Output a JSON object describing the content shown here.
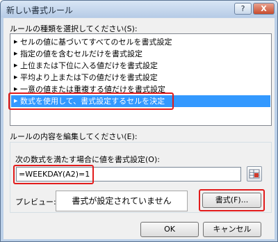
{
  "dialog": {
    "title": "新しい書式ルール",
    "help_label": "?",
    "close_label": "X"
  },
  "rule_type": {
    "label": "ルールの種類を選択してください(S):",
    "items": [
      "セルの値に基づいてすべてのセルを書式設定",
      "指定の値を含むセルだけを書式設定",
      "上位または下位に入る値だけを書式設定",
      "平均より上または下の値だけを書式設定",
      "一意の値または重複する値だけを書式設定",
      "数式を使用して、書式設定するセルを決定"
    ],
    "selected_index": 5
  },
  "rule_edit": {
    "label": "ルールの内容を編集してください(E):",
    "formula_label": "次の数式を満たす場合に値を書式設定(O):",
    "formula_value": "=WEEKDAY(A2)=1"
  },
  "preview": {
    "label": "プレビュー:",
    "text": "書式が設定されていません"
  },
  "buttons": {
    "format": "書式(F)...",
    "ok": "OK",
    "cancel": "キャンセル"
  },
  "colors": {
    "highlight": "#3399ff",
    "annotation": "#e21b1b"
  }
}
